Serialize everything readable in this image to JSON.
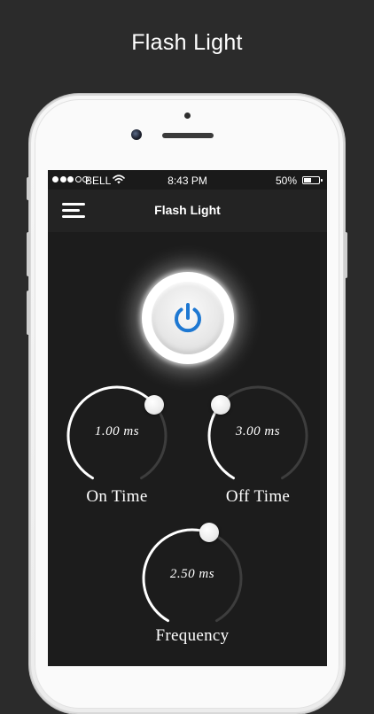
{
  "promo": {
    "title": "Flash Light"
  },
  "status_bar": {
    "signal_dots_filled": 3,
    "signal_dots_total": 5,
    "carrier": "BELL",
    "time": "8:43 PM",
    "battery_percent": "50%",
    "battery_level": 0.5
  },
  "nav": {
    "menu_icon": "hamburger-menu-icon",
    "title": "Flash Light"
  },
  "power_button": {
    "icon": "power-icon",
    "accent_color": "#1e78d2"
  },
  "dials": [
    {
      "value": "1.00 ms",
      "label": "On Time",
      "knob_angle_deg": 40
    },
    {
      "value": "3.00 ms",
      "label": "Off Time",
      "knob_angle_deg": 140
    },
    {
      "value": "2.50 ms",
      "label": "Frequency",
      "knob_angle_deg": 70
    }
  ],
  "colors": {
    "screen_bg": "#1c1c1c",
    "navbar_bg": "#232323",
    "arc_active": "#ffffff",
    "arc_inactive": "#3d3d3d"
  }
}
